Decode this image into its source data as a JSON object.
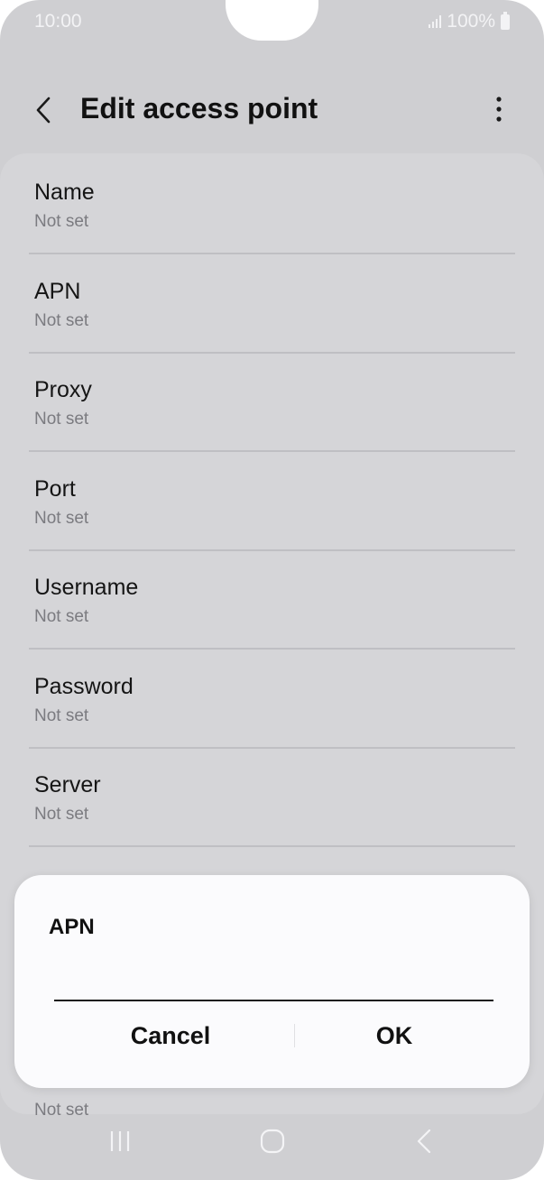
{
  "status_bar": {
    "time": "10:00",
    "battery": "100%"
  },
  "header": {
    "title": "Edit access point"
  },
  "settings": {
    "rows": [
      {
        "label": "Name",
        "value": "Not set"
      },
      {
        "label": "APN",
        "value": "Not set"
      },
      {
        "label": "Proxy",
        "value": "Not set"
      },
      {
        "label": "Port",
        "value": "Not set"
      },
      {
        "label": "Username",
        "value": "Not set"
      },
      {
        "label": "Password",
        "value": "Not set"
      },
      {
        "label": "Server",
        "value": "Not set"
      }
    ],
    "partial_bottom_value": "Not set"
  },
  "dialog": {
    "title": "APN",
    "input_value": "",
    "cancel_label": "Cancel",
    "ok_label": "OK"
  },
  "nav_icons": [
    "recents-icon",
    "home-icon",
    "back-nav-icon"
  ]
}
